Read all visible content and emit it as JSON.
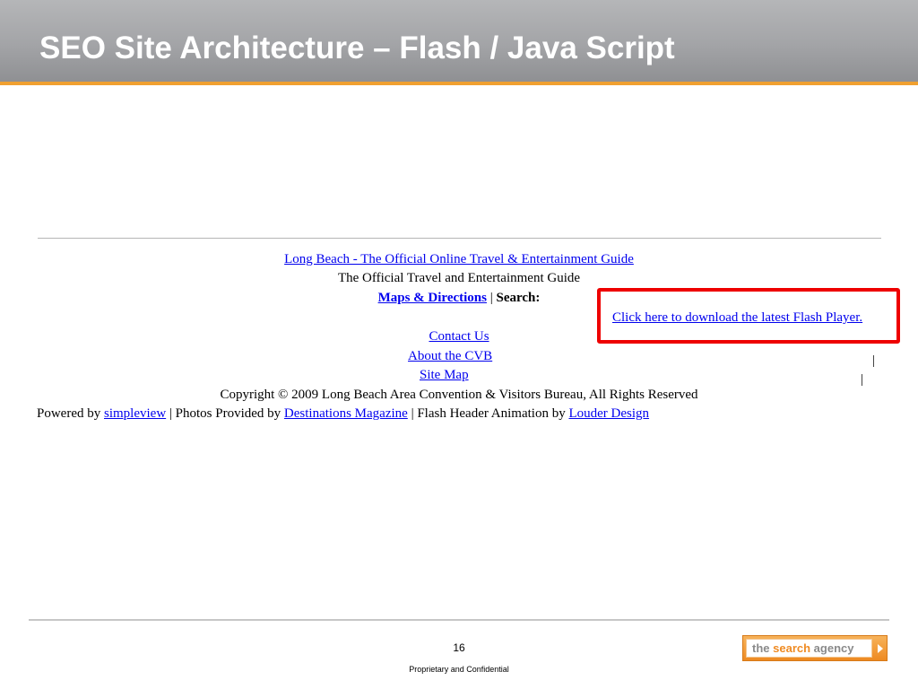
{
  "slide": {
    "title": "SEO Site Architecture – Flash / Java Script",
    "page_number": "16",
    "confidential": "Proprietary and Confidential",
    "logo": {
      "word1": "the",
      "word2": "search",
      "word3": "agency"
    }
  },
  "colors": {
    "highlight_border": "#ee0000",
    "link": "#0000ee",
    "accent": "#f0a030"
  },
  "page": {
    "title_link": "Long Beach - The Official Online Travel & Entertainment Guide",
    "subtitle": "The Official Travel and Entertainment Guide",
    "maps_link": "Maps & Directions",
    "separator": "|",
    "search_label": "Search:",
    "flash_link": "Click here to download the latest Flash Player.",
    "links": {
      "contact": "Contact Us",
      "about": "About the CVB",
      "sitemap": "Site Map"
    },
    "copyright": "Copyright © 2009 Long Beach Area Convention & Visitors Bureau, All Rights Reserved",
    "powered": {
      "prefix": "Powered by",
      "simpleview": "simpleview",
      "photos_text": "| Photos Provided by",
      "destinations": "Destinations Magazine",
      "flash_text": "| Flash Header Animation by",
      "louder": "Louder Design"
    },
    "stray_pipe_1": "|",
    "stray_pipe_2": "|"
  }
}
